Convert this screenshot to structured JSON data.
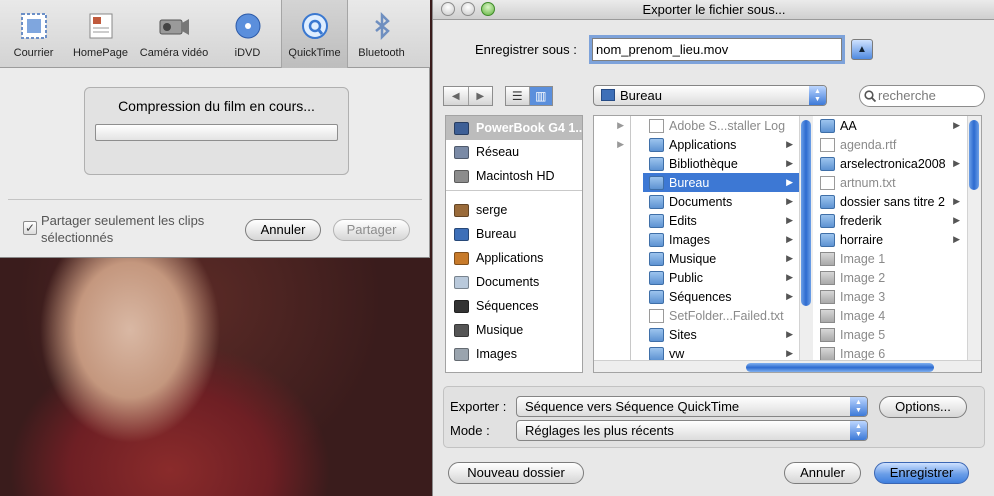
{
  "share": {
    "toolbar": [
      {
        "label": "Courrier",
        "icon": "mail-stamp-icon"
      },
      {
        "label": "HomePage",
        "icon": "homepage-icon"
      },
      {
        "label": "Caméra vidéo",
        "icon": "camcorder-icon"
      },
      {
        "label": "iDVD",
        "icon": "dvd-disc-icon"
      },
      {
        "label": "QuickTime",
        "icon": "quicktime-icon",
        "selected": true
      },
      {
        "label": "Bluetooth",
        "icon": "bluetooth-icon"
      }
    ],
    "progress_label": "Compression du film en cours...",
    "progress_fraction": 0.0,
    "checkbox_label": "Partager seulement les clips sélectionnés",
    "checkbox_checked": true,
    "cancel_label": "Annuler",
    "share_label": "Partager"
  },
  "export": {
    "window_title": "Exporter le fichier sous...",
    "saveas_label": "Enregistrer sous :",
    "filename": "nom_prenom_lieu.mov",
    "location": "Bureau",
    "search_placeholder": "recherche",
    "sidebar": [
      {
        "label": "PowerBook G4 1...",
        "icon": "laptop-icon",
        "selected": true
      },
      {
        "label": "Réseau",
        "icon": "network-globe-icon"
      },
      {
        "label": "Macintosh HD",
        "icon": "hard-drive-icon"
      },
      {
        "label": "serge",
        "icon": "home-icon",
        "section_start": true
      },
      {
        "label": "Bureau",
        "icon": "desktop-icon"
      },
      {
        "label": "Applications",
        "icon": "applications-icon"
      },
      {
        "label": "Documents",
        "icon": "documents-folder-icon"
      },
      {
        "label": "Séquences",
        "icon": "movies-icon"
      },
      {
        "label": "Musique",
        "icon": "music-icon"
      },
      {
        "label": "Images",
        "icon": "pictures-icon"
      }
    ],
    "column1": [
      {
        "has_arrow": true
      },
      {
        "has_arrow": true
      }
    ],
    "column2": [
      {
        "label": "Adobe S...staller Log",
        "type": "doc",
        "dim": true
      },
      {
        "label": "Applications",
        "type": "folder",
        "arrow": true
      },
      {
        "label": "Bibliothèque",
        "type": "folder",
        "arrow": true
      },
      {
        "label": "Bureau",
        "type": "folder",
        "arrow": true,
        "selected": true
      },
      {
        "label": "Documents",
        "type": "folder",
        "arrow": true
      },
      {
        "label": "Edits",
        "type": "folder",
        "arrow": true
      },
      {
        "label": "Images",
        "type": "folder",
        "arrow": true
      },
      {
        "label": "Musique",
        "type": "folder",
        "arrow": true
      },
      {
        "label": "Public",
        "type": "folder",
        "arrow": true
      },
      {
        "label": "Séquences",
        "type": "folder",
        "arrow": true
      },
      {
        "label": "SetFolder...Failed.txt",
        "type": "doc",
        "dim": true
      },
      {
        "label": "Sites",
        "type": "folder",
        "arrow": true
      },
      {
        "label": "vw",
        "type": "folder",
        "arrow": true
      }
    ],
    "column3": [
      {
        "label": "AA",
        "type": "folder",
        "arrow": true
      },
      {
        "label": "agenda.rtf",
        "type": "doc",
        "dim": true
      },
      {
        "label": "arselectronica2008",
        "type": "folder",
        "arrow": true
      },
      {
        "label": "artnum.txt",
        "type": "doc",
        "dim": true
      },
      {
        "label": "dossier sans titre 2",
        "type": "folder",
        "arrow": true
      },
      {
        "label": "frederik",
        "type": "folder",
        "arrow": true
      },
      {
        "label": "horraire",
        "type": "folder",
        "arrow": true
      },
      {
        "label": "Image 1",
        "type": "img",
        "dim": true
      },
      {
        "label": "Image 2",
        "type": "img",
        "dim": true
      },
      {
        "label": "Image 3",
        "type": "img",
        "dim": true
      },
      {
        "label": "Image 4",
        "type": "img",
        "dim": true
      },
      {
        "label": "Image 5",
        "type": "img",
        "dim": true
      },
      {
        "label": "Image 6",
        "type": "img",
        "dim": true
      }
    ],
    "export_label": "Exporter :",
    "export_value": "Séquence vers Séquence QuickTime",
    "options_label": "Options...",
    "mode_label": "Mode :",
    "mode_value": "Réglages les plus récents",
    "new_folder_label": "Nouveau dossier",
    "cancel_label": "Annuler",
    "save_label": "Enregistrer"
  },
  "colors": {
    "selection": "#3d78d4",
    "default_button": "#4f8ae0"
  }
}
